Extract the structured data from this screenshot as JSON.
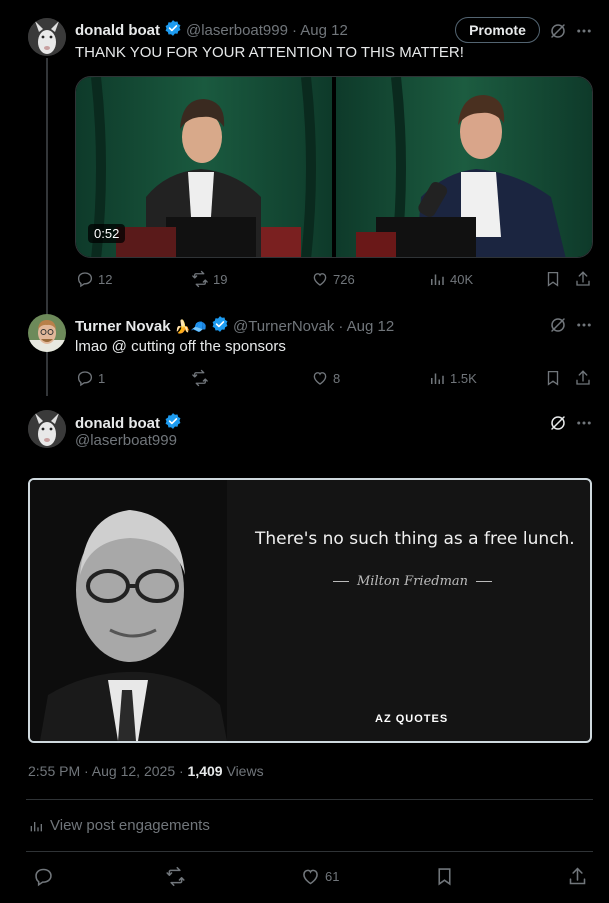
{
  "tweet1": {
    "author_name": "donald boat",
    "handle": "@laserboat999",
    "date": "· Aug 12",
    "text": "THANK YOU FOR YOUR ATTENTION TO THIS MATTER!",
    "promote_label": "Promote",
    "video_duration": "0:52",
    "replies": "12",
    "retweets": "19",
    "likes": "726",
    "views": "40K"
  },
  "tweet2": {
    "author_name": "Turner Novak",
    "emojis": "🍌🧢",
    "handle": "@TurnerNovak",
    "date": "· Aug 12",
    "text": "lmao @ cutting off the sponsors",
    "replies": "1",
    "retweets": "",
    "likes": "8",
    "views": "1.5K"
  },
  "main_tweet": {
    "author_name": "donald boat",
    "handle": "@laserboat999",
    "quote_text": "There's no such thing as a free lunch.",
    "quote_author": "Milton Friedman",
    "quote_brand": "AZ QUOTES",
    "timestamp": "2:55 PM · Aug 12, 2025 · ",
    "views_count": "1,409",
    "views_label": " Views",
    "engagements_label": "View post engagements",
    "likes": "61"
  },
  "colors": {
    "background": "#000000",
    "text_primary": "#e7e9ea",
    "text_muted": "#71767b",
    "verified_blue": "#1d9bf0",
    "border": "#2f3336"
  }
}
